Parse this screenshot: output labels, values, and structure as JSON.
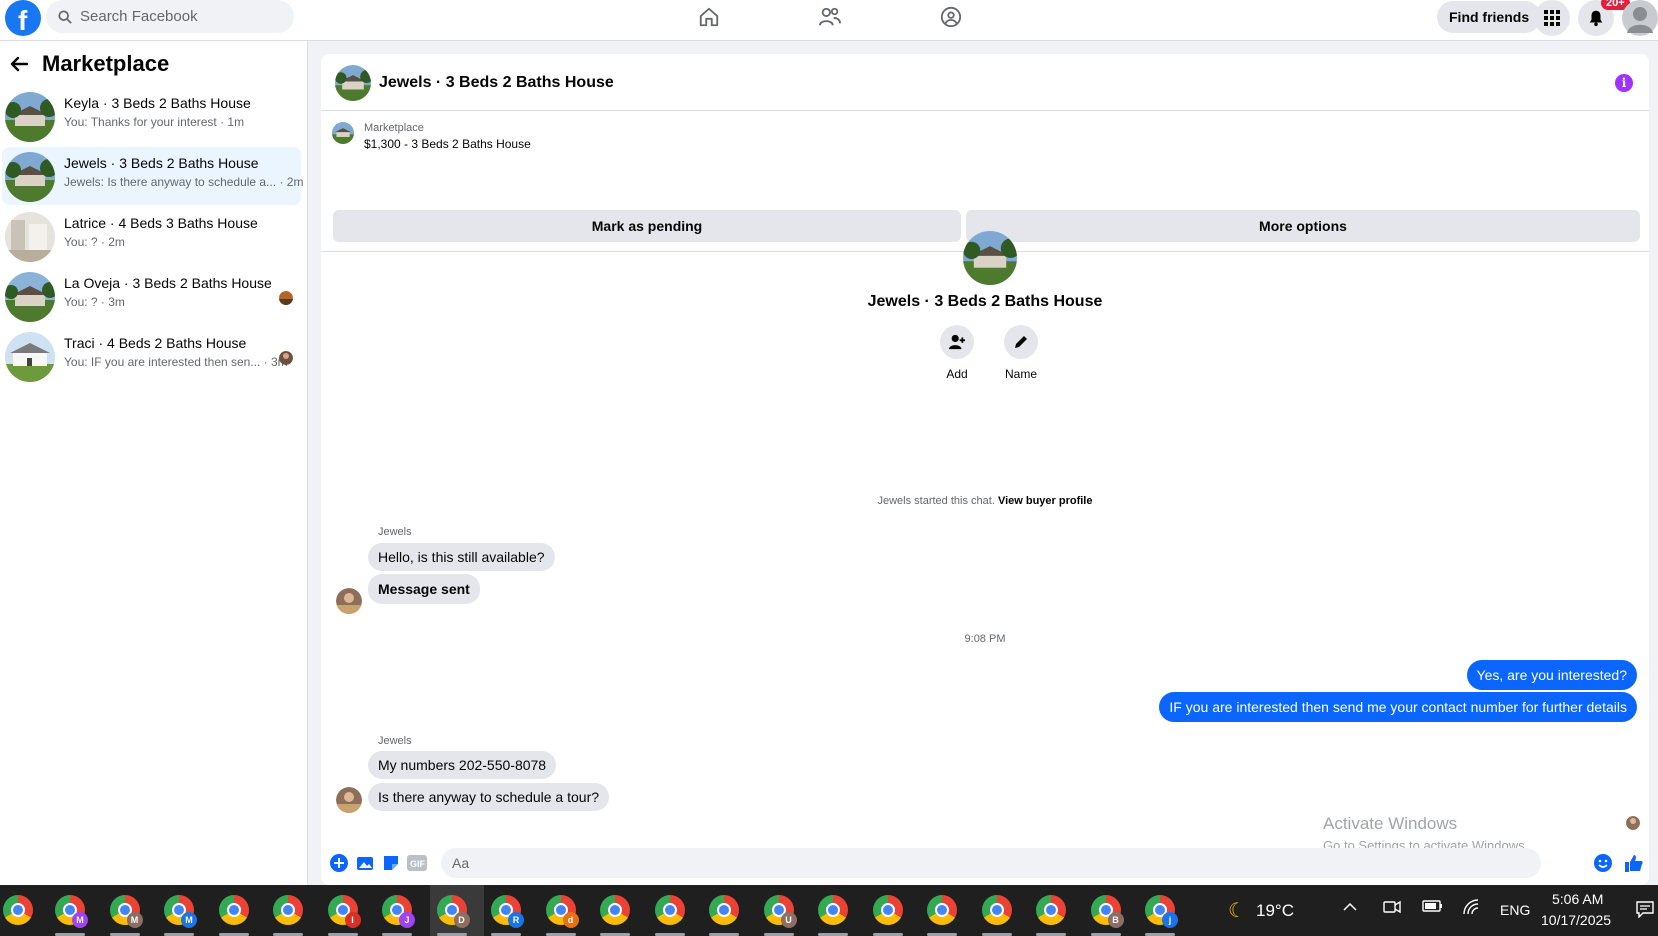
{
  "topbar": {
    "search_placeholder": "Search Facebook",
    "find_friends_label": "Find friends",
    "notification_badge": "20+"
  },
  "sidebar": {
    "title": "Marketplace",
    "conversations": [
      {
        "title": "Keyla · 3 Beds 2 Baths House",
        "subtitle": "You: Thanks for your interest · 1m",
        "active": false
      },
      {
        "title": "Jewels · 3 Beds 2 Baths House",
        "subtitle": "Jewels: Is there anyway to schedule a... · 2m",
        "active": true
      },
      {
        "title": "Latrice · 4 Beds 3 Baths House",
        "subtitle": "You: ? · 2m",
        "active": false
      },
      {
        "title": "La Oveja · 3 Beds 2 Baths House",
        "subtitle": "You: ? · 3m",
        "active": false
      },
      {
        "title": "Traci · 4 Beds 2 Baths House",
        "subtitle": "You: IF you are interested then sen... · 3m",
        "active": false
      }
    ]
  },
  "chat": {
    "header_title": "Jewels · 3 Beds 2 Baths House",
    "listing_label": "Marketplace",
    "listing_price": "$1,300 - 3 Beds 2 Baths House",
    "mark_pending_label": "Mark as pending",
    "more_options_label": "More options",
    "profile_name": "Jewels · 3 Beds 2 Baths House",
    "add_label": "Add",
    "name_label": "Name",
    "started_note": "Jewels started this chat.",
    "view_profile_link": "View buyer profile",
    "sender_name": "Jewels",
    "msg1": "Hello, is this still available?",
    "msg2": "Message sent",
    "timestamp": "9:08 PM",
    "out1": "Yes, are you interested?",
    "out2": "IF you are interested then send me your contact number for further details",
    "msg3": "My numbers 202-550-8078",
    "msg4": "Is there anyway to schedule a tour?",
    "composer_placeholder": "Aa"
  },
  "watermark": {
    "line1": "Activate Windows",
    "line2": "Go to Settings to activate Windows."
  },
  "taskbar": {
    "app_badges": [
      "",
      "M",
      "M",
      "M",
      "",
      "",
      "I",
      "J",
      "D",
      "R",
      "d",
      "",
      "",
      "",
      "U",
      "",
      "",
      "",
      "",
      "",
      "B",
      "j"
    ],
    "temperature": "19°C",
    "language": "ENG",
    "time": "5:06 AM",
    "date": "10/17/2025"
  },
  "colors": {
    "facebook_blue": "#1877f2",
    "outgoing_bubble": "#0a66ff",
    "active_conversation": "#ebf5ff",
    "info_icon": "#a033ff"
  }
}
